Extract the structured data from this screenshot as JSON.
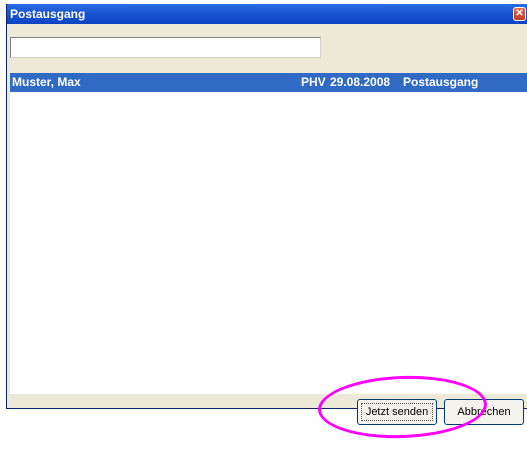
{
  "window": {
    "title": "Postausgang",
    "close_icon": "close-icon"
  },
  "search": {
    "value": "",
    "placeholder": ""
  },
  "list": {
    "rows": [
      {
        "name": "Muster, Max",
        "code": "PHV",
        "date": "29.08.2008",
        "type": "Postausgang",
        "selected": true
      }
    ]
  },
  "buttons": {
    "send_label": "Jetzt senden",
    "cancel_label": "Abbrechen"
  },
  "colors": {
    "titlebar": "#0a44c4",
    "selection": "#316ac5",
    "dialog_bg": "#ece9d8",
    "highlight": "#ff00ff"
  }
}
